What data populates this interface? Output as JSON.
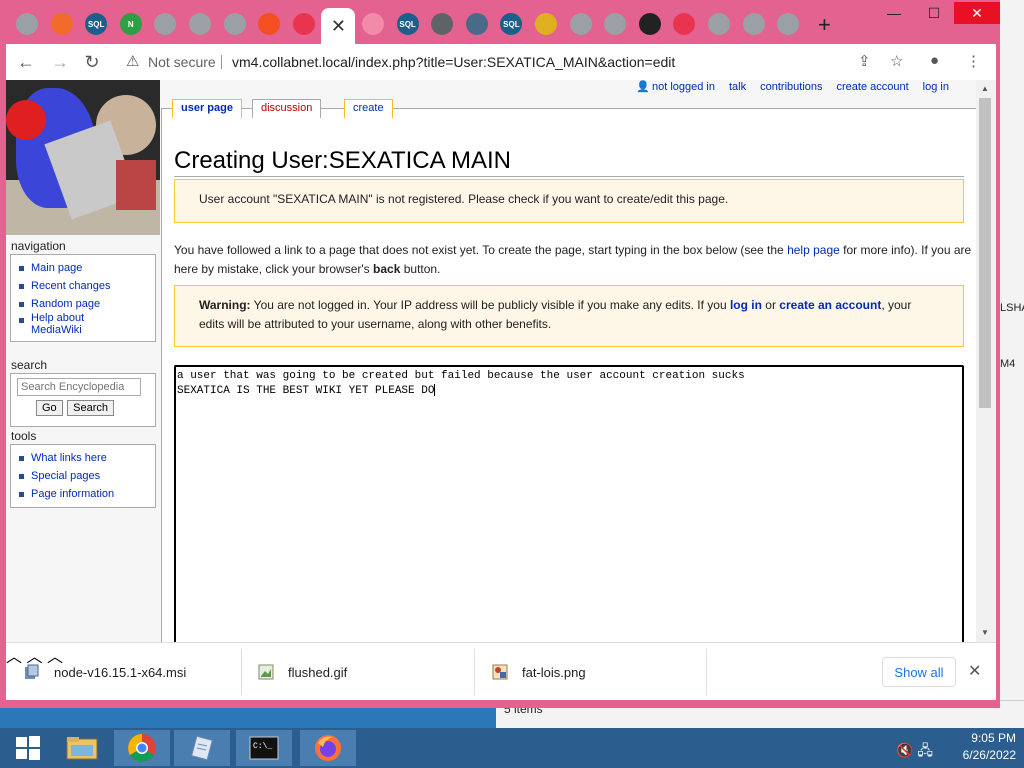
{
  "browser": {
    "tabs": [
      {
        "icon": "globe-icon",
        "label": ""
      },
      {
        "icon": "media-icon",
        "label": ""
      },
      {
        "icon": "sqlite-icon",
        "label": "SQL"
      },
      {
        "icon": "n-icon",
        "label": "N"
      },
      {
        "icon": "download-icon",
        "label": ""
      },
      {
        "icon": "globe-icon",
        "label": ""
      },
      {
        "icon": "globe-icon",
        "label": ""
      },
      {
        "icon": "windows-icon",
        "label": ""
      },
      {
        "icon": "circle-icon",
        "label": ""
      },
      {
        "icon": "close-icon",
        "label": "✕"
      },
      {
        "icon": "heart-icon",
        "label": ""
      },
      {
        "icon": "sqlite-icon",
        "label": "SQL"
      },
      {
        "icon": "chrome-icon",
        "label": ""
      },
      {
        "icon": "diamond-icon",
        "label": ""
      },
      {
        "icon": "sqlite-icon",
        "label": "SQL"
      },
      {
        "icon": "book-icon",
        "label": ""
      },
      {
        "icon": "gear-icon",
        "label": ""
      },
      {
        "icon": "globe-icon",
        "label": ""
      },
      {
        "icon": "wiki-icon",
        "label": ""
      },
      {
        "icon": "circle-icon",
        "label": ""
      },
      {
        "icon": "globe-icon",
        "label": ""
      },
      {
        "icon": "globe-icon",
        "label": ""
      },
      {
        "icon": "gear-icon",
        "label": ""
      }
    ],
    "new_tab": "+",
    "window_buttons": {
      "minimize": "—",
      "maximize": "☐",
      "close": "✕"
    },
    "nav": {
      "back": "←",
      "forward": "→",
      "reload": "↻"
    },
    "security_icon": "⚠",
    "not_secure": "Not secure",
    "url": "vm4.collabnet.local/index.php?title=User:SEXATICA_MAIN&action=edit",
    "toolbar_icons": {
      "share": "⇪",
      "star": "☆",
      "profile": "●",
      "menu": "⋮"
    }
  },
  "wiki": {
    "personal": {
      "not_logged_in": "not logged in",
      "talk": "talk",
      "contributions": "contributions",
      "create_account": "create account",
      "log_in": "log in"
    },
    "tabs": {
      "user_page": "user page",
      "discussion": "discussion",
      "create": "create"
    },
    "title": "Creating User:SEXATICA MAIN",
    "notice": "User account \"SEXATICA MAIN\" is not registered. Please check if you want to create/edit this page.",
    "intro": {
      "part1": "You have followed a link to a page that does not exist yet. To create the page, start typing in the box below (see the ",
      "help_link": "help page",
      "part2": " for more info). If you are here by mistake, click your browser's ",
      "back": "back",
      "part3": " button."
    },
    "warning": {
      "label": "Warning:",
      "part1": " You are not logged in. Your IP address will be publicly visible if you make any edits. If you ",
      "log_in": "log in",
      "or": " or ",
      "create_account": "create an account",
      "part2": ", your edits will be attributed to your username, along with other benefits."
    },
    "editor_lines": [
      "a user that was going to be created but failed because the user account creation sucks",
      "SEXATICA IS THE BEST WIKI YET PLEASE DO"
    ],
    "sidebar": {
      "navigation_title": "navigation",
      "navigation": [
        "Main page",
        "Recent changes",
        "Random page"
      ],
      "help_about_1": "Help about",
      "help_about_2": "MediaWiki",
      "search_title": "search",
      "search_placeholder": "Search Encyclopedia",
      "go": "Go",
      "search": "Search",
      "tools_title": "tools",
      "tools": [
        "What links here",
        "Special pages",
        "Page information"
      ]
    }
  },
  "downloads": {
    "items": [
      "node-v16.15.1-x64.msi",
      "flushed.gif",
      "fat-lois.png"
    ],
    "show_all": "Show all",
    "close": "✕"
  },
  "desktop": {
    "frag1": "LSHA",
    "frag2": "M4",
    "bottom_text": "5 items"
  },
  "taskbar": {
    "time": "9:05 PM",
    "date": "6/26/2022"
  }
}
